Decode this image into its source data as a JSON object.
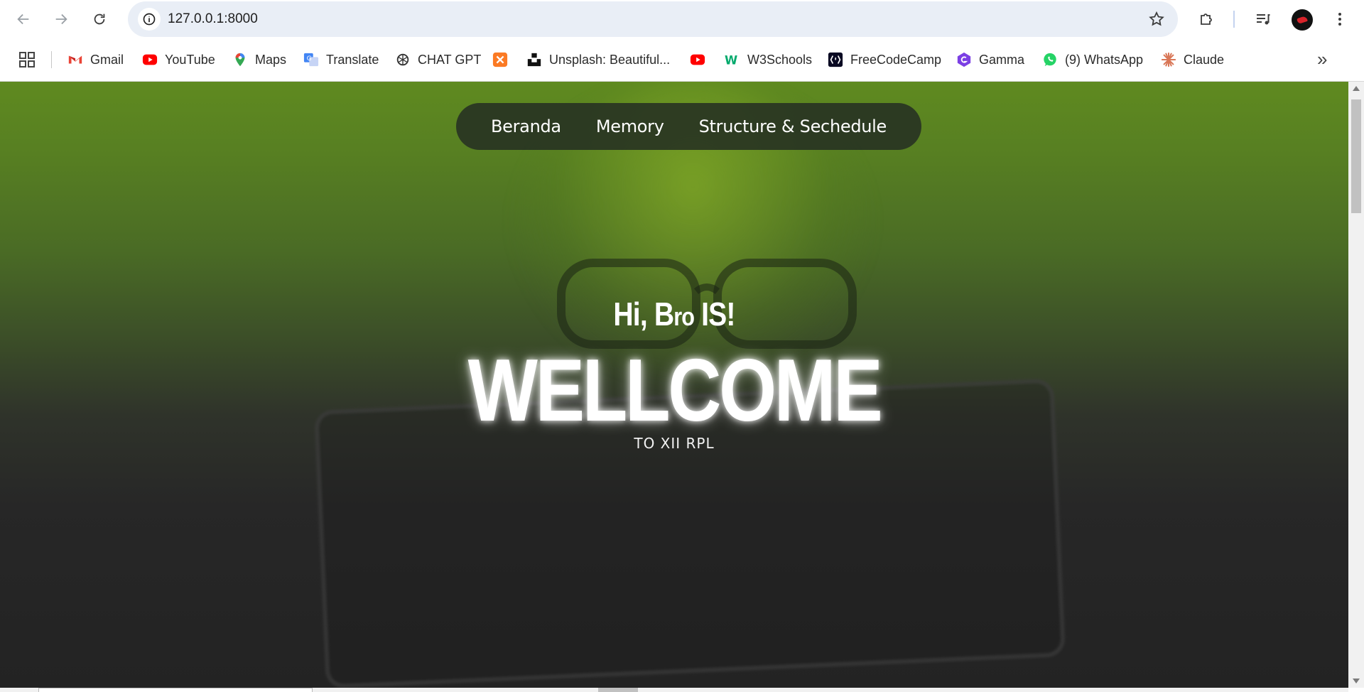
{
  "browser": {
    "url": "127.0.0.1:8000",
    "bookmarks": [
      {
        "label": "Gmail",
        "icon": "gmail-icon"
      },
      {
        "label": "YouTube",
        "icon": "youtube-icon"
      },
      {
        "label": "Maps",
        "icon": "maps-icon"
      },
      {
        "label": "Translate",
        "icon": "translate-icon"
      },
      {
        "label": "CHAT GPT",
        "icon": "chatgpt-icon"
      },
      {
        "label": "",
        "icon": "xampp-icon"
      },
      {
        "label": "Unsplash: Beautiful...",
        "icon": "unsplash-icon"
      },
      {
        "label": "",
        "icon": "youtube-icon"
      },
      {
        "label": "W3Schools",
        "icon": "w3schools-icon"
      },
      {
        "label": "FreeCodeCamp",
        "icon": "freecodecamp-icon"
      },
      {
        "label": "Gamma",
        "icon": "gamma-icon"
      },
      {
        "label": "(9) WhatsApp",
        "icon": "whatsapp-icon"
      },
      {
        "label": "Claude",
        "icon": "claude-icon"
      }
    ],
    "colors": {
      "omnibox_bg": "#e9eef6",
      "accent": "#1a73e8"
    }
  },
  "page": {
    "menu": [
      "Beranda",
      "Memory",
      "Structure & Sechedule"
    ],
    "greeting_hi": "Hi,",
    "greeting_name_first": "B",
    "greeting_name_rest": "ro",
    "greeting_name_suffix": "IS!",
    "hero_title": "WELLCOME",
    "subtitle": "TO XII RPL",
    "colors": {
      "hero_top": "#5f8a20",
      "hero_bottom": "#232323",
      "menu_bg": "#263022"
    }
  }
}
